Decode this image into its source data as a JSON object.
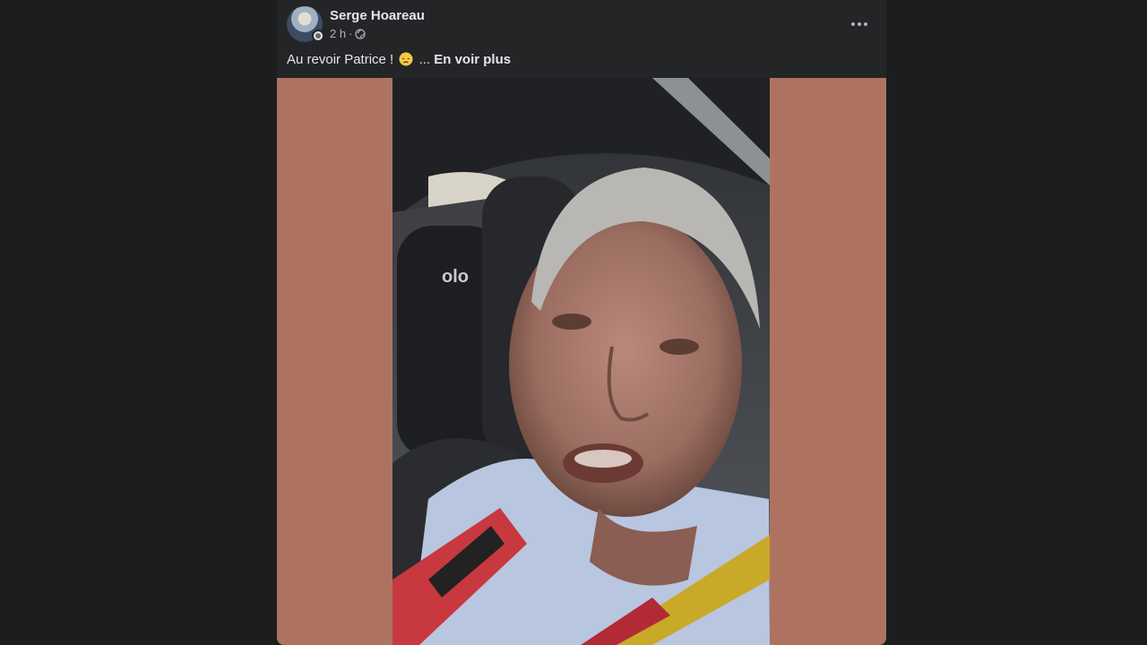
{
  "post": {
    "author": "Serge Hoareau",
    "time": "2 h",
    "separator": "·",
    "audience_icon": "globe-icon",
    "text": "Au revoir Patrice !",
    "emoji": "disappointed-face-emoji",
    "ellipsis": "...",
    "see_more": "En voir plus",
    "more_icon": "more-horizontal-icon"
  },
  "media": {
    "type": "video",
    "letterbox_color": "#ad7360"
  },
  "colors": {
    "background": "#1c1d1f",
    "card": "#242526",
    "primary_text": "#e4e6eb",
    "secondary_text": "#b0b3b8"
  }
}
